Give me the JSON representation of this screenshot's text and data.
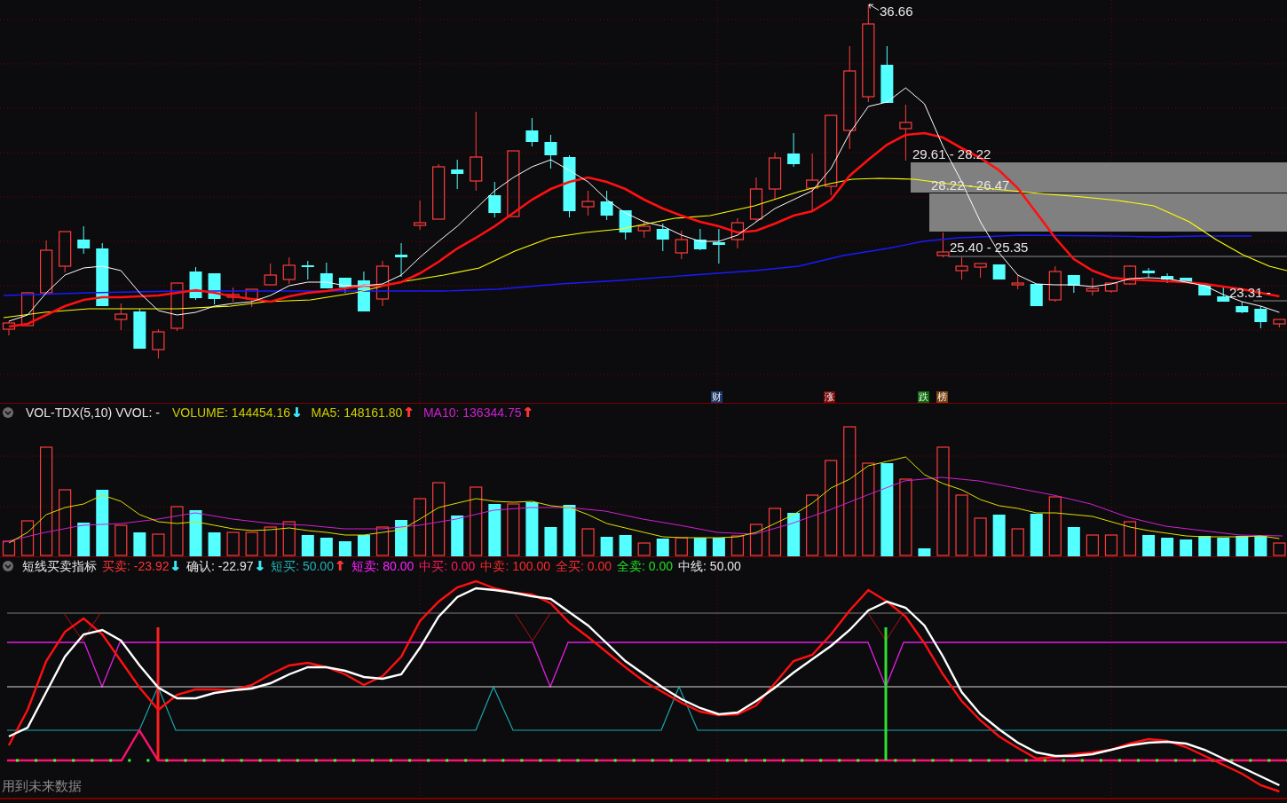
{
  "price_panel": {
    "price_labels": [
      "36.66",
      "29.61 - 28.22",
      "28.22 - 26.47",
      "25.40 - 25.35",
      "23.31 -"
    ],
    "event_tags": [
      {
        "label": "财",
        "color": "#1b3a6b"
      },
      {
        "label": "涨",
        "color": "#7a0a0a"
      },
      {
        "label": "跌",
        "color": "#0a6a0a"
      },
      {
        "label": "榜",
        "color": "#7a4010"
      }
    ]
  },
  "volume_panel": {
    "title": "VOL-TDX(5,10) VVOL: -",
    "readings": [
      {
        "text": "VOLUME: 144454.16",
        "color": "#cccc00",
        "arrow": {
          "glyph": "↓",
          "color": "#3ee6f5"
        }
      },
      {
        "text": "MA5: 148161.80",
        "color": "#cccc00",
        "arrow": {
          "glyph": "↑",
          "color": "#ff3434"
        }
      },
      {
        "text": "MA10: 136344.75",
        "color": "#cc22cc",
        "arrow": {
          "glyph": "↑",
          "color": "#ff3434"
        }
      }
    ]
  },
  "indicator_panel": {
    "title": "短线买卖指标",
    "readings": [
      {
        "text": "买卖: -23.92",
        "color": "#ff3232",
        "arrow": {
          "glyph": "↓",
          "color": "#3ee6f5"
        }
      },
      {
        "text": "确认: -22.97",
        "color": "#e6e6e6",
        "arrow": {
          "glyph": "↓",
          "color": "#3ee6f5"
        }
      },
      {
        "text": "短买: 50.00",
        "color": "#20b2b2",
        "arrow": {
          "glyph": "↑",
          "color": "#ff3434"
        }
      },
      {
        "text": "短卖: 80.00",
        "color": "#ff22ff"
      },
      {
        "text": "中买: 0.00",
        "color": "#ff1a5a"
      },
      {
        "text": "中卖: 100.00",
        "color": "#ff2a2a"
      },
      {
        "text": "全买: 0.00",
        "color": "#ff2b2b"
      },
      {
        "text": "全卖: 0.00",
        "color": "#20e020"
      },
      {
        "text": "中线: 50.00",
        "color": "#e6e6e5"
      }
    ],
    "notice": "用到未来数据"
  }
}
